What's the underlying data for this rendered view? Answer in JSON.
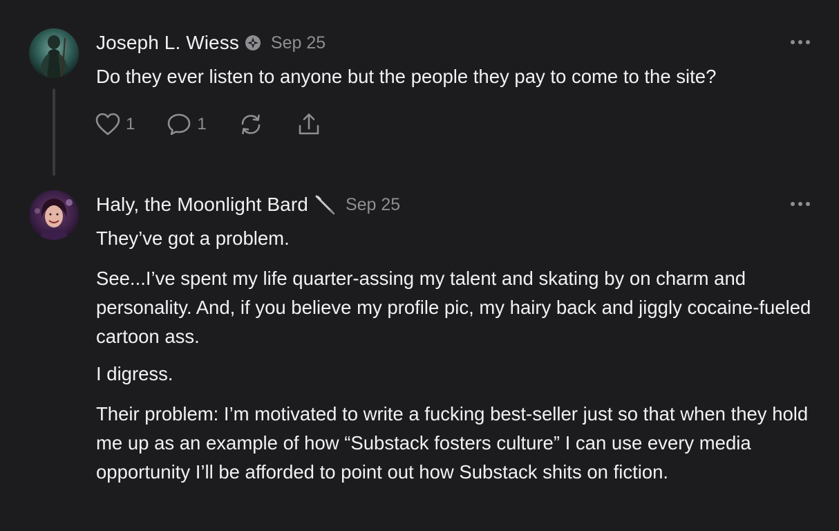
{
  "comments": [
    {
      "author": "Joseph L. Wiess",
      "badge_icon": "subscriber-badge-icon",
      "date": "Sep 25",
      "paragraphs": [
        "Do they ever listen to anyone but the people they pay to come to the site?"
      ],
      "actions": {
        "like_count": "1",
        "reply_count": "1"
      }
    },
    {
      "author": "Haly, the Moonlight Bard",
      "badge_icon": "quill-pen-icon",
      "date": "Sep 25",
      "paragraphs": [
        "They’ve got a problem.",
        "See...I’ve spent my life quarter-assing my talent and skating by on charm and personality. And, if you believe my profile pic, my hairy back and jiggly cocaine-fueled cartoon ass.",
        "I digress.",
        "Their problem: I’m motivated to write a fucking best-seller just so that when they hold me up as an example of how “Substack fosters culture” I can use every media opportunity I’ll be afforded to point out how Substack shits on fiction."
      ]
    }
  ],
  "colors": {
    "background": "#1c1c1e",
    "text": "#f2f2f4",
    "muted": "#8e8e93",
    "thread_line": "#3a3a3c"
  }
}
